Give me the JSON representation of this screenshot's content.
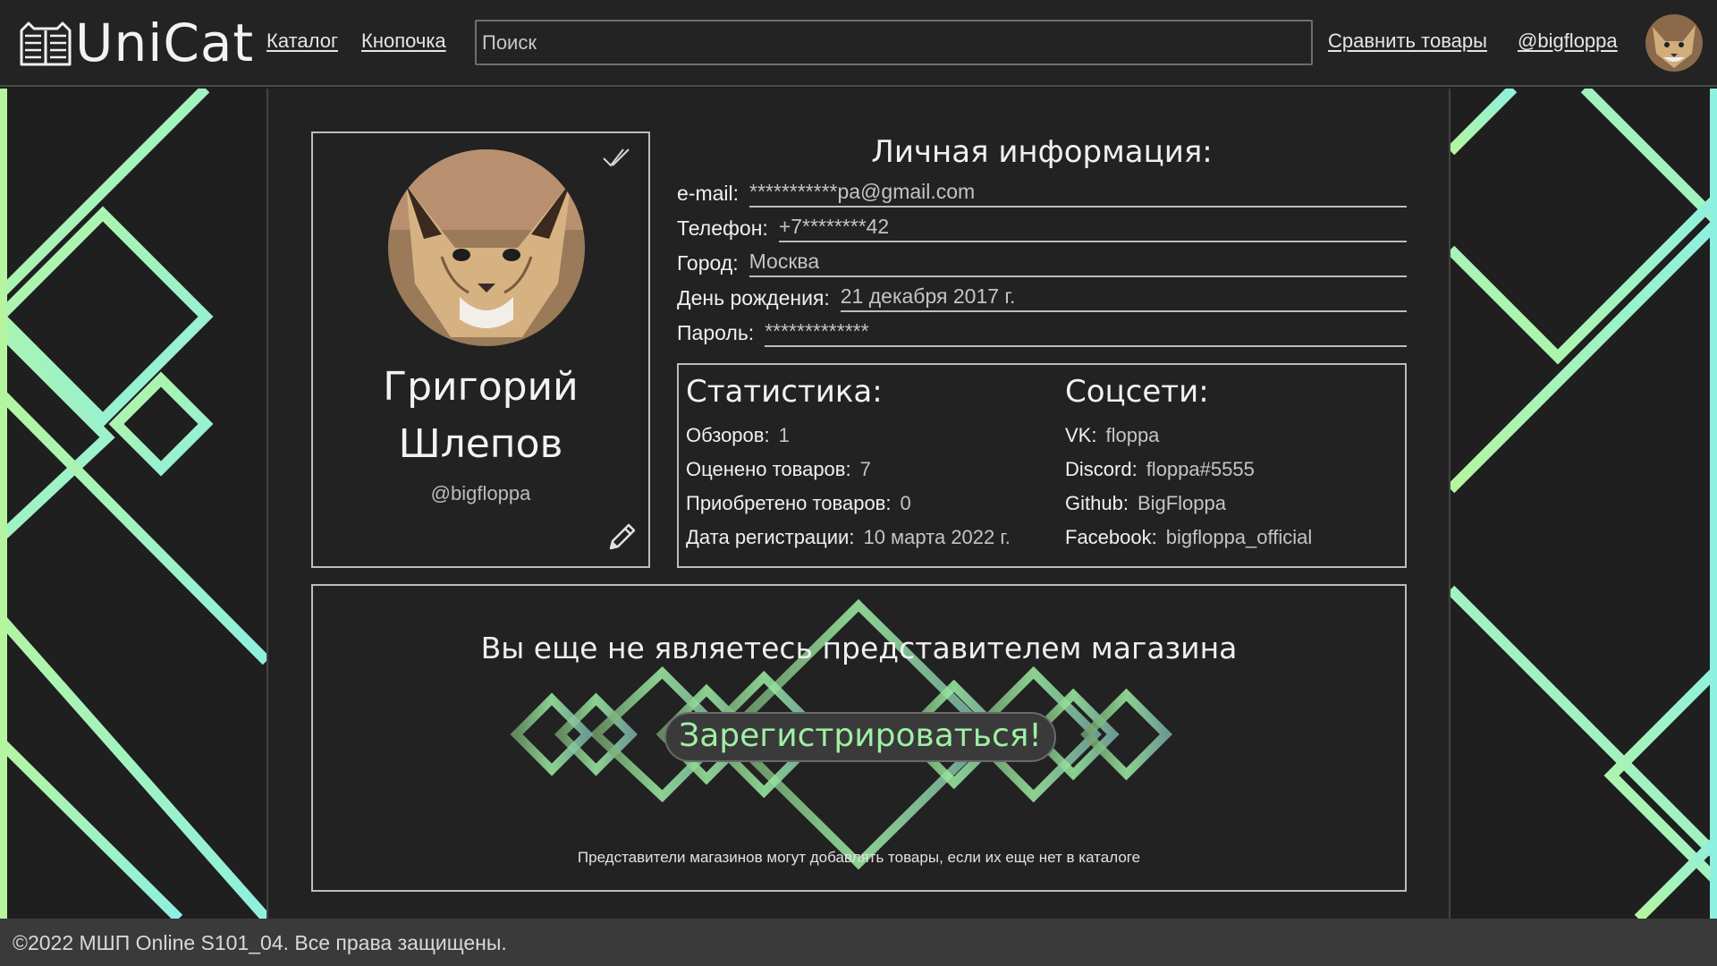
{
  "header": {
    "logo_text": "UniCat",
    "nav": {
      "catalog": "Каталог",
      "button": "Кнопочка"
    },
    "search_placeholder": "Поиск",
    "compare": "Сравнить товары",
    "username": "@bigfloppa"
  },
  "profile": {
    "first_name": "Григорий",
    "last_name": "Шлепов",
    "nick": "@bigfloppa"
  },
  "personal_info": {
    "title": "Личная информация:",
    "rows": [
      {
        "label": "e-mail:",
        "value": "***********pa@gmail.com"
      },
      {
        "label": "Телефон:",
        "value": "+7********42"
      },
      {
        "label": "Город:",
        "value": "Москва"
      },
      {
        "label": "День рождения:",
        "value": "21 декабря 2017 г."
      },
      {
        "label": "Пароль:",
        "value": "*************"
      }
    ]
  },
  "stats": {
    "title": "Статистика:",
    "rows": [
      {
        "label": "Обзоров:",
        "value": "1"
      },
      {
        "label": "Оценено товаров:",
        "value": "7"
      },
      {
        "label": "Приобретено товаров:",
        "value": "0"
      },
      {
        "label": "Дата регистрации:",
        "value": "10 марта 2022 г."
      }
    ]
  },
  "socials": {
    "title": "Соцсети:",
    "rows": [
      {
        "label": "VK:",
        "value": "floppa"
      },
      {
        "label": "Discord:",
        "value": "floppa#5555"
      },
      {
        "label": "Github:",
        "value": "BigFloppa"
      },
      {
        "label": "Facebook:",
        "value": "bigfloppa_official"
      }
    ]
  },
  "seller": {
    "title": "Вы еще не являетесь представителем магазина",
    "button": "Зарегистрироваться!",
    "note": "Представители магазинов могут добавлять товары, если их еще нет в каталоге"
  },
  "footer": {
    "text": "©2022 МШП Online S101_04. Все права защищены."
  },
  "colors": {
    "accent_green": "#9ef0a4",
    "accent_cyan": "#8ef0e0",
    "background": "#1f1f1f"
  },
  "icons": [
    "logo-book-cat-icon",
    "check-icon",
    "pencil-icon"
  ]
}
